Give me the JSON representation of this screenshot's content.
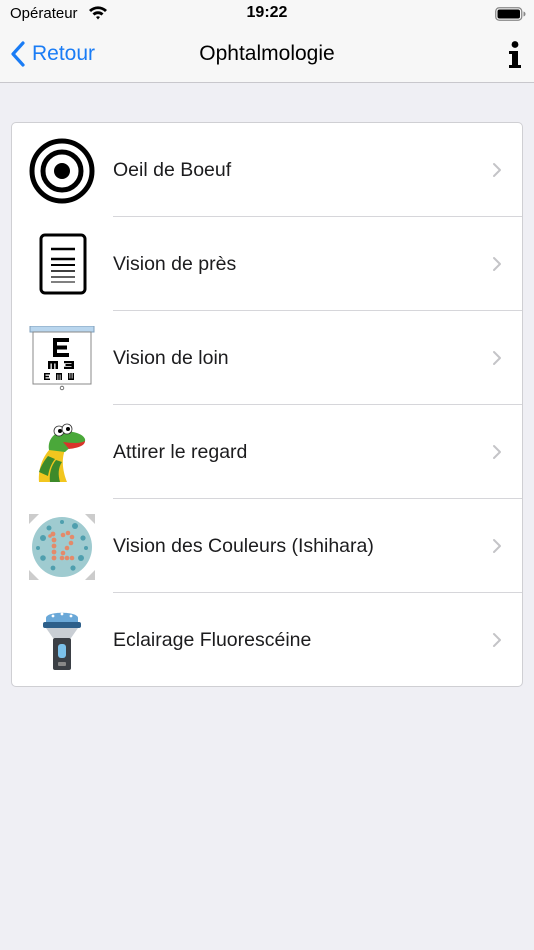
{
  "status": {
    "carrier": "Opérateur",
    "time": "19:22"
  },
  "nav": {
    "back_label": "Retour",
    "title": "Ophtalmologie",
    "info_icon": "info-icon"
  },
  "menu": {
    "items": [
      {
        "label": "Oeil de Boeuf",
        "icon": "bullseye-icon"
      },
      {
        "label": "Vision de près",
        "icon": "reading-card-icon"
      },
      {
        "label": "Vision de loin",
        "icon": "eye-chart-icon"
      },
      {
        "label": "Attirer le regard",
        "icon": "sock-puppet-icon"
      },
      {
        "label": "Vision des Couleurs (Ishihara)",
        "icon": "ishihara-plate-icon"
      },
      {
        "label": "Eclairage Fluorescéine",
        "icon": "penlight-icon"
      }
    ]
  },
  "colors": {
    "accent": "#1a7cf5",
    "background": "#efeff4",
    "separator": "#d6d6da"
  }
}
